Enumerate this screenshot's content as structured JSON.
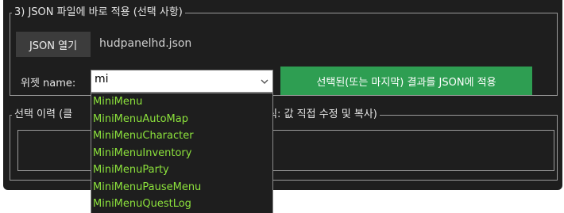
{
  "section_json": {
    "title": "3) JSON 파일에 바로 적용 (선택 사항)",
    "open_button": "JSON 열기",
    "filename": "hudpanelhd.json",
    "widget_label": "위젯 name:",
    "widget_value": "mi",
    "apply_button": "선택된(또는 마지막) 결과를 JSON에 적용"
  },
  "section_history": {
    "title_left": "선택 이력 (클",
    "title_right": "클릭: 값 직접 수정 및 복사)"
  },
  "dropdown": {
    "items": [
      "MiniMenu",
      "MiniMenuAutoMap",
      "MiniMenuCharacter",
      "MiniMenuInventory",
      "MiniMenuParty",
      "MiniMenuPauseMenu",
      "MiniMenuQuestLog"
    ]
  },
  "colors": {
    "background": "#1e1e1e",
    "accent_green": "#2e9e52",
    "dropdown_text": "#8ce23c"
  },
  "icons": {
    "combo_arrow": "chevron-down-icon"
  }
}
